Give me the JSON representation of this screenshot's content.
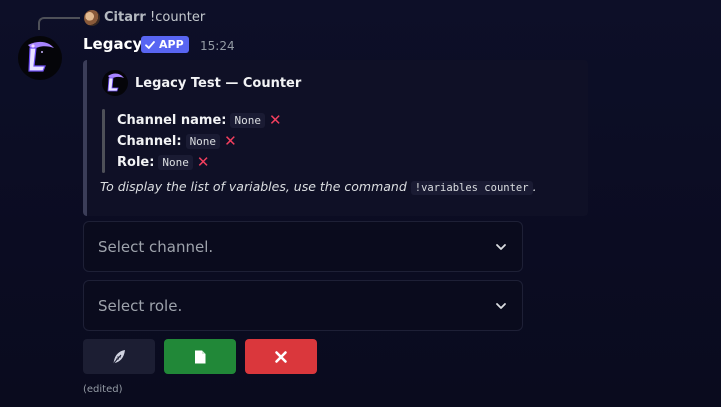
{
  "reply": {
    "author": "Citarr",
    "text": "!counter"
  },
  "message": {
    "author": "Legacy",
    "badge": "APP",
    "timestamp": "15:24",
    "edited_label": "(edited)"
  },
  "embed": {
    "title": "Legacy Test — Counter",
    "fields": [
      {
        "label": "Channel name:",
        "value": "None"
      },
      {
        "label": "Channel:",
        "value": "None"
      },
      {
        "label": "Role:",
        "value": "None"
      }
    ],
    "footnote_prefix": "To display the list of variables, use the command",
    "footnote_command": "!variables counter",
    "footnote_suffix": "."
  },
  "selects": [
    {
      "placeholder": "Select channel."
    },
    {
      "placeholder": "Select role."
    }
  ],
  "buttons": {
    "edit_icon": "feather-icon",
    "save_icon": "file-icon",
    "cancel_icon": "close-icon"
  },
  "colors": {
    "app_badge": "#5865f2",
    "save_button": "#218838",
    "cancel_button": "#da373c",
    "edit_button": "#1c1e33",
    "status_x": "#f23f5e"
  }
}
